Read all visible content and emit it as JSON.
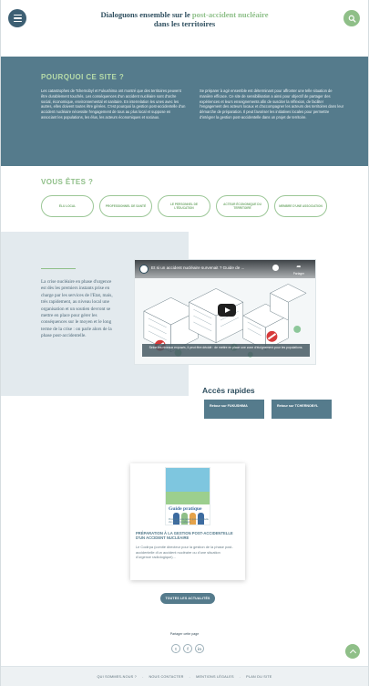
{
  "header": {
    "title_part1": "Dialoguons ensemble sur le ",
    "title_accent": "post-accident nucléaire",
    "title_line2": "dans les territoires",
    "menu_icon": "hamburger-menu-icon",
    "search_icon": "search-icon"
  },
  "why": {
    "title": "POURQUOI CE SITE ?",
    "left_text": "Les catastrophes de Tchernobyl et Fukushima ont montré que des territoires peuvent être durablement touchés. Les conséquences d'un accident nucléaire sont d'ordre social, économique, environnemental et sanitaire. En interrelation les unes avec les autres, elles doivent toutes être gérées. C'est pourquoi la gestion post-accidentelle d'un accident nucléaire nécessite l'engagement de tous au plus local et suppose en associant les populations, les élus, les acteurs économiques et sociaux.",
    "right_text": "Se préparer à agir ensemble est déterminant pour affronter une telle situation de manière efficace. Ce site de sensibilisation a ainsi pour objectif de partager des expériences et leurs enseignements afin de susciter la réflexion, de faciliter l'engagement des acteurs locaux et d'accompagner les acteurs des territoires dans leur démarche de préparation. Il peut favoriser les initiatives locales pour permettre d'intégrer la gestion post-accidentelle dans un projet de territoire.",
    "bg_color": "#557b8c",
    "title_color": "#b7dca9"
  },
  "you_are": {
    "title": "VOUS ÊTES ?",
    "roles": [
      "ÉLU LOCAL",
      "PROFESSIONNEL DE SANTÉ",
      "LE PERSONNEL DE L'ÉDUCATION",
      "ACTEUR ÉCONOMIQUE DU TERRITOIRE",
      "MEMBRE D'UNE ASSOCIATION"
    ]
  },
  "crisis": {
    "text": "La crise nucléaire en phase d'urgence est dès les premiers instants prise en charge par les services de l'Etat, mais, très rapidement, au niveau local une organisation et un soutien devront se mettre en place pour gérer les conséquences sur le moyen et le long terme de la crise : on parle alors de la phase post-accidentelle."
  },
  "video": {
    "title": "Et si un accident nucléaire survenait ? Guide de ...",
    "watch_label": "",
    "share_label": "Partager",
    "caption": "Selon les niveaux exposés, il peut être décidé : de mettre en place une zone d'éloignement pour les populations."
  },
  "quick_access": {
    "title": "Accès rapides",
    "buttons": [
      "Retour sur FUKUSHIMA",
      "Retour sur TCHERNOBYL"
    ]
  },
  "news": {
    "thumb_title": "Guide pratique",
    "thumb_sub": "Préparation à la gestion post-accidentelle d'un accident nucléaire",
    "heading": "PRÉPARATION À LA GESTION POST-ACCIDENTELLE D'UN ACCIDENT NUCLÉAIRE",
    "body": "Le Codirpa (comité directeur pour la gestion de la phase post-accidentelle d'un accident nucléaire ou d'une situation d'urgence radiologique)...",
    "all_news_label": "TOUTES LES ACTUALITÉS"
  },
  "share": {
    "label": "Partager cette page",
    "icons": [
      "twitter-icon",
      "facebook-icon",
      "linkedin-icon"
    ],
    "glyphs": [
      "t",
      "f",
      "in"
    ]
  },
  "footer": {
    "links": [
      "QUI SOMMES-NOUS ?",
      "NOUS CONTACTER",
      "MENTIONS LÉGALES",
      "PLAN DU SITE"
    ],
    "separator": "-"
  },
  "colors": {
    "accent_green": "#8fbf88",
    "primary_blue": "#557b8c",
    "dark_blue": "#2f4f5f"
  }
}
